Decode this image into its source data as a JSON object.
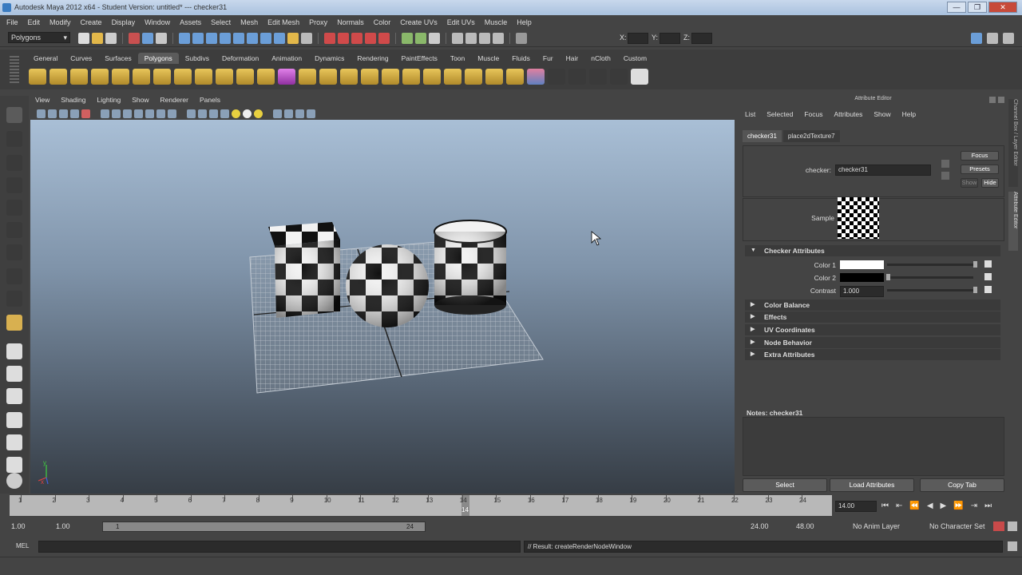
{
  "window": {
    "title": "Autodesk Maya 2012 x64 - Student Version: untitled*   ---   checker31",
    "controls": [
      "—",
      "❐",
      "✕"
    ]
  },
  "menubar": [
    "File",
    "Edit",
    "Modify",
    "Create",
    "Display",
    "Window",
    "Assets",
    "Select",
    "Mesh",
    "Edit Mesh",
    "Proxy",
    "Normals",
    "Color",
    "Create UVs",
    "Edit UVs",
    "Muscle",
    "Help"
  ],
  "statusline": {
    "mode": "Polygons",
    "x_label": "X:",
    "y_label": "Y:",
    "z_label": "Z:"
  },
  "shelf": {
    "tabs": [
      "General",
      "Curves",
      "Surfaces",
      "Polygons",
      "Subdivs",
      "Deformation",
      "Animation",
      "Dynamics",
      "Rendering",
      "PaintEffects",
      "Toon",
      "Muscle",
      "Fluids",
      "Fur",
      "Hair",
      "nCloth",
      "Custom"
    ],
    "active_tab": "Polygons"
  },
  "viewport": {
    "menu": [
      "View",
      "Shading",
      "Lighting",
      "Show",
      "Renderer",
      "Panels"
    ]
  },
  "attribute_editor": {
    "title": "Attribute Editor",
    "menu": [
      "List",
      "Selected",
      "Focus",
      "Attributes",
      "Show",
      "Help"
    ],
    "tabs": [
      "checker31",
      "place2dTexture7"
    ],
    "node_label": "checker:",
    "node_value": "checker31",
    "buttons": {
      "focus": "Focus",
      "presets": "Presets",
      "show": "Show",
      "hide": "Hide"
    },
    "sample_label": "Sample",
    "sections": [
      {
        "label": "Checker Attributes",
        "expanded": true
      },
      {
        "label": "Color Balance",
        "expanded": false
      },
      {
        "label": "Effects",
        "expanded": false
      },
      {
        "label": "UV Coordinates",
        "expanded": false
      },
      {
        "label": "Node Behavior",
        "expanded": false
      },
      {
        "label": "Extra Attributes",
        "expanded": false
      }
    ],
    "attrs": {
      "color1_label": "Color 1",
      "color1": "#ffffff",
      "color2_label": "Color 2",
      "color2": "#000000",
      "contrast_label": "Contrast",
      "contrast_value": "1.000"
    },
    "notes_label": "Notes:  checker31",
    "bottom_buttons": [
      "Select",
      "Load Attributes",
      "Copy Tab"
    ]
  },
  "side_tabs": [
    "Channel Box / Layer Editor",
    "Attribute Editor"
  ],
  "timeline": {
    "ticks": [
      "1",
      "2",
      "3",
      "4",
      "5",
      "6",
      "7",
      "8",
      "9",
      "10",
      "11",
      "12",
      "13",
      "14",
      "15",
      "16",
      "17",
      "18",
      "19",
      "20",
      "21",
      "22",
      "23",
      "24"
    ],
    "current_frame": "14",
    "current_field": "14.00"
  },
  "range": {
    "start": "1.00",
    "start2": "1.00",
    "range_start": "1",
    "range_end": "24",
    "end": "24.00",
    "end2": "48.00",
    "anim_layer": "No Anim Layer",
    "char_set": "No Character Set"
  },
  "command": {
    "label": "MEL",
    "result": "// Result: createRenderNodeWindow"
  },
  "axis": {
    "x": "x",
    "y": "y"
  }
}
